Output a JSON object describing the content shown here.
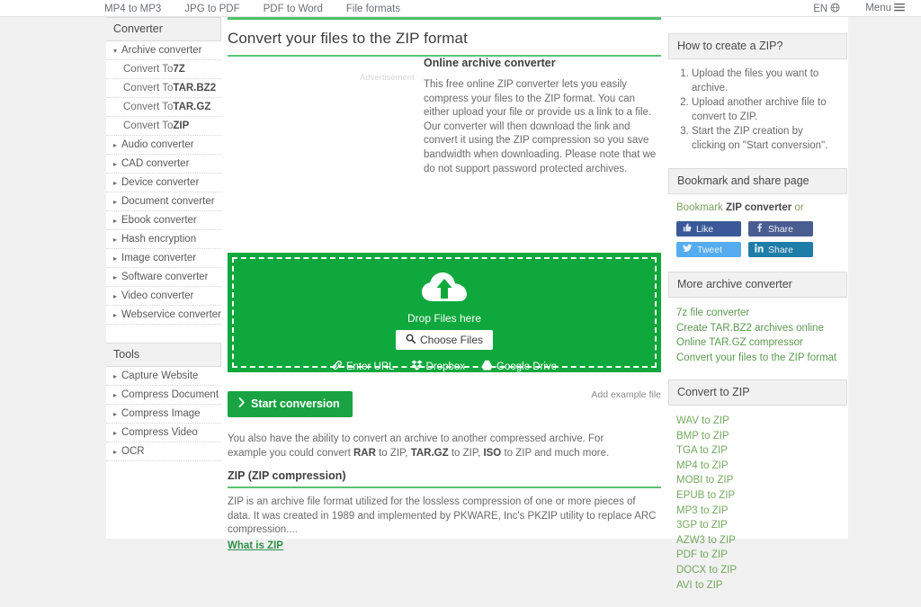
{
  "topnav": {
    "left_items": [
      {
        "label": "MP4 to MP3",
        "name": "topnav-mp4-to-mp3"
      },
      {
        "label": "JPG to PDF",
        "name": "topnav-jpg-to-pdf"
      },
      {
        "label": "PDF to Word",
        "name": "topnav-pdf-to-word"
      },
      {
        "label": "File formats",
        "name": "topnav-file-formats"
      }
    ],
    "language": "EN",
    "menu": "Menu"
  },
  "sidebar": {
    "converter_title": "Converter",
    "items": [
      {
        "label": "Archive converter",
        "expanded": true
      },
      {
        "label": "Audio converter",
        "expanded": false
      },
      {
        "label": "CAD converter",
        "expanded": false
      },
      {
        "label": "Device converter",
        "expanded": false
      },
      {
        "label": "Document converter",
        "expanded": false
      },
      {
        "label": "Ebook converter",
        "expanded": false
      },
      {
        "label": "Hash encryption",
        "expanded": false
      },
      {
        "label": "Image converter",
        "expanded": false
      },
      {
        "label": "Software converter",
        "expanded": false
      },
      {
        "label": "Video converter",
        "expanded": false
      },
      {
        "label": "Webservice converter",
        "expanded": false
      }
    ],
    "archive_children": [
      {
        "prefix": "Convert To ",
        "format": "7Z"
      },
      {
        "prefix": "Convert To ",
        "format": "TAR.BZ2"
      },
      {
        "prefix": "Convert To ",
        "format": "TAR.GZ"
      },
      {
        "prefix": "Convert To ",
        "format": "ZIP"
      }
    ],
    "tools_title": "Tools",
    "tools": [
      {
        "label": "Capture Website"
      },
      {
        "label": "Compress Document"
      },
      {
        "label": "Compress Image"
      },
      {
        "label": "Compress Video"
      },
      {
        "label": "OCR"
      }
    ]
  },
  "main": {
    "heading": "Convert your files to the ZIP format",
    "ad_label": "Advertisement",
    "intro_title": "Online archive converter",
    "intro_body": "This free online ZIP converter lets you easily compress your files to the ZIP format. You can either upload your file or provide us a link to a file. Our converter will then download the link and convert it using the ZIP compression so you save bandwidth when downloading. Please note that we do not support password protected archives.",
    "dropzone": {
      "drop_text": "Drop Files here",
      "choose_files": "Choose Files",
      "sources": [
        {
          "label": "Enter URL",
          "icon": "link-icon"
        },
        {
          "label": "Dropbox",
          "icon": "dropbox-icon"
        },
        {
          "label": "Google Drive",
          "icon": "google-drive-icon"
        }
      ]
    },
    "start_button": "Start conversion",
    "add_example": "Add example file",
    "alt_note_1": "You also have the ability to convert an archive to another compressed archive. For example you could convert ",
    "alt_note_rar": "RAR",
    "alt_note_2": " to ZIP, ",
    "alt_note_targz": "TAR.GZ",
    "alt_note_3": " to ZIP, ",
    "alt_note_iso": "ISO",
    "alt_note_4": " to ZIP and much more.",
    "format_title": "ZIP (ZIP compression)",
    "format_body": "ZIP is an archive file format utilized for the lossless compression of one or more pieces of data. It was created in 1989 and implemented by PKWARE, Inc's PKZIP utility to replace ARC compression....",
    "format_more": "What is ZIP"
  },
  "right": {
    "howto_title": "How to create a ZIP?",
    "howto_steps": [
      "Upload the files you want to archive.",
      "Upload another archive file to convert to ZIP.",
      "Start the ZIP creation by clicking on \"Start conversion\"."
    ],
    "bookmark_title": "Bookmark and share page",
    "bookmark_prefix": "Bookmark ",
    "bookmark_strong": "ZIP converter",
    "bookmark_suffix": " or",
    "social": [
      {
        "label": "Like",
        "icon": "thumbs-up-icon",
        "color": "#3b5998"
      },
      {
        "label": "Share",
        "icon": "facebook-icon",
        "color": "#4a5d90"
      },
      {
        "label": "Tweet",
        "icon": "twitter-icon",
        "color": "#55acee"
      },
      {
        "label": "Share",
        "icon": "linkedin-icon",
        "color": "#1e7ca8"
      }
    ],
    "more_title": "More archive converter",
    "more_links": [
      "7z file converter",
      "Create TAR.BZ2 archives online",
      "Online TAR.GZ compressor",
      "Convert your files to the ZIP format"
    ],
    "convert_title": "Convert to ZIP",
    "convert_links": [
      "WAV to ZIP",
      "BMP to ZIP",
      "TGA to ZIP",
      "MP4 to ZIP",
      "MOBI to ZIP",
      "EPUB to ZIP",
      "MP3 to ZIP",
      "3GP to ZIP",
      "AZW3 to ZIP",
      "PDF to ZIP",
      "DOCX to ZIP",
      "AVI to ZIP"
    ]
  },
  "colors": {
    "accent_green": "#0fa83c",
    "rule_green": "#4fc06a",
    "button_green": "#1aa342",
    "link_green": "#5c9a4f",
    "page_bg": "#f1f1f1"
  }
}
